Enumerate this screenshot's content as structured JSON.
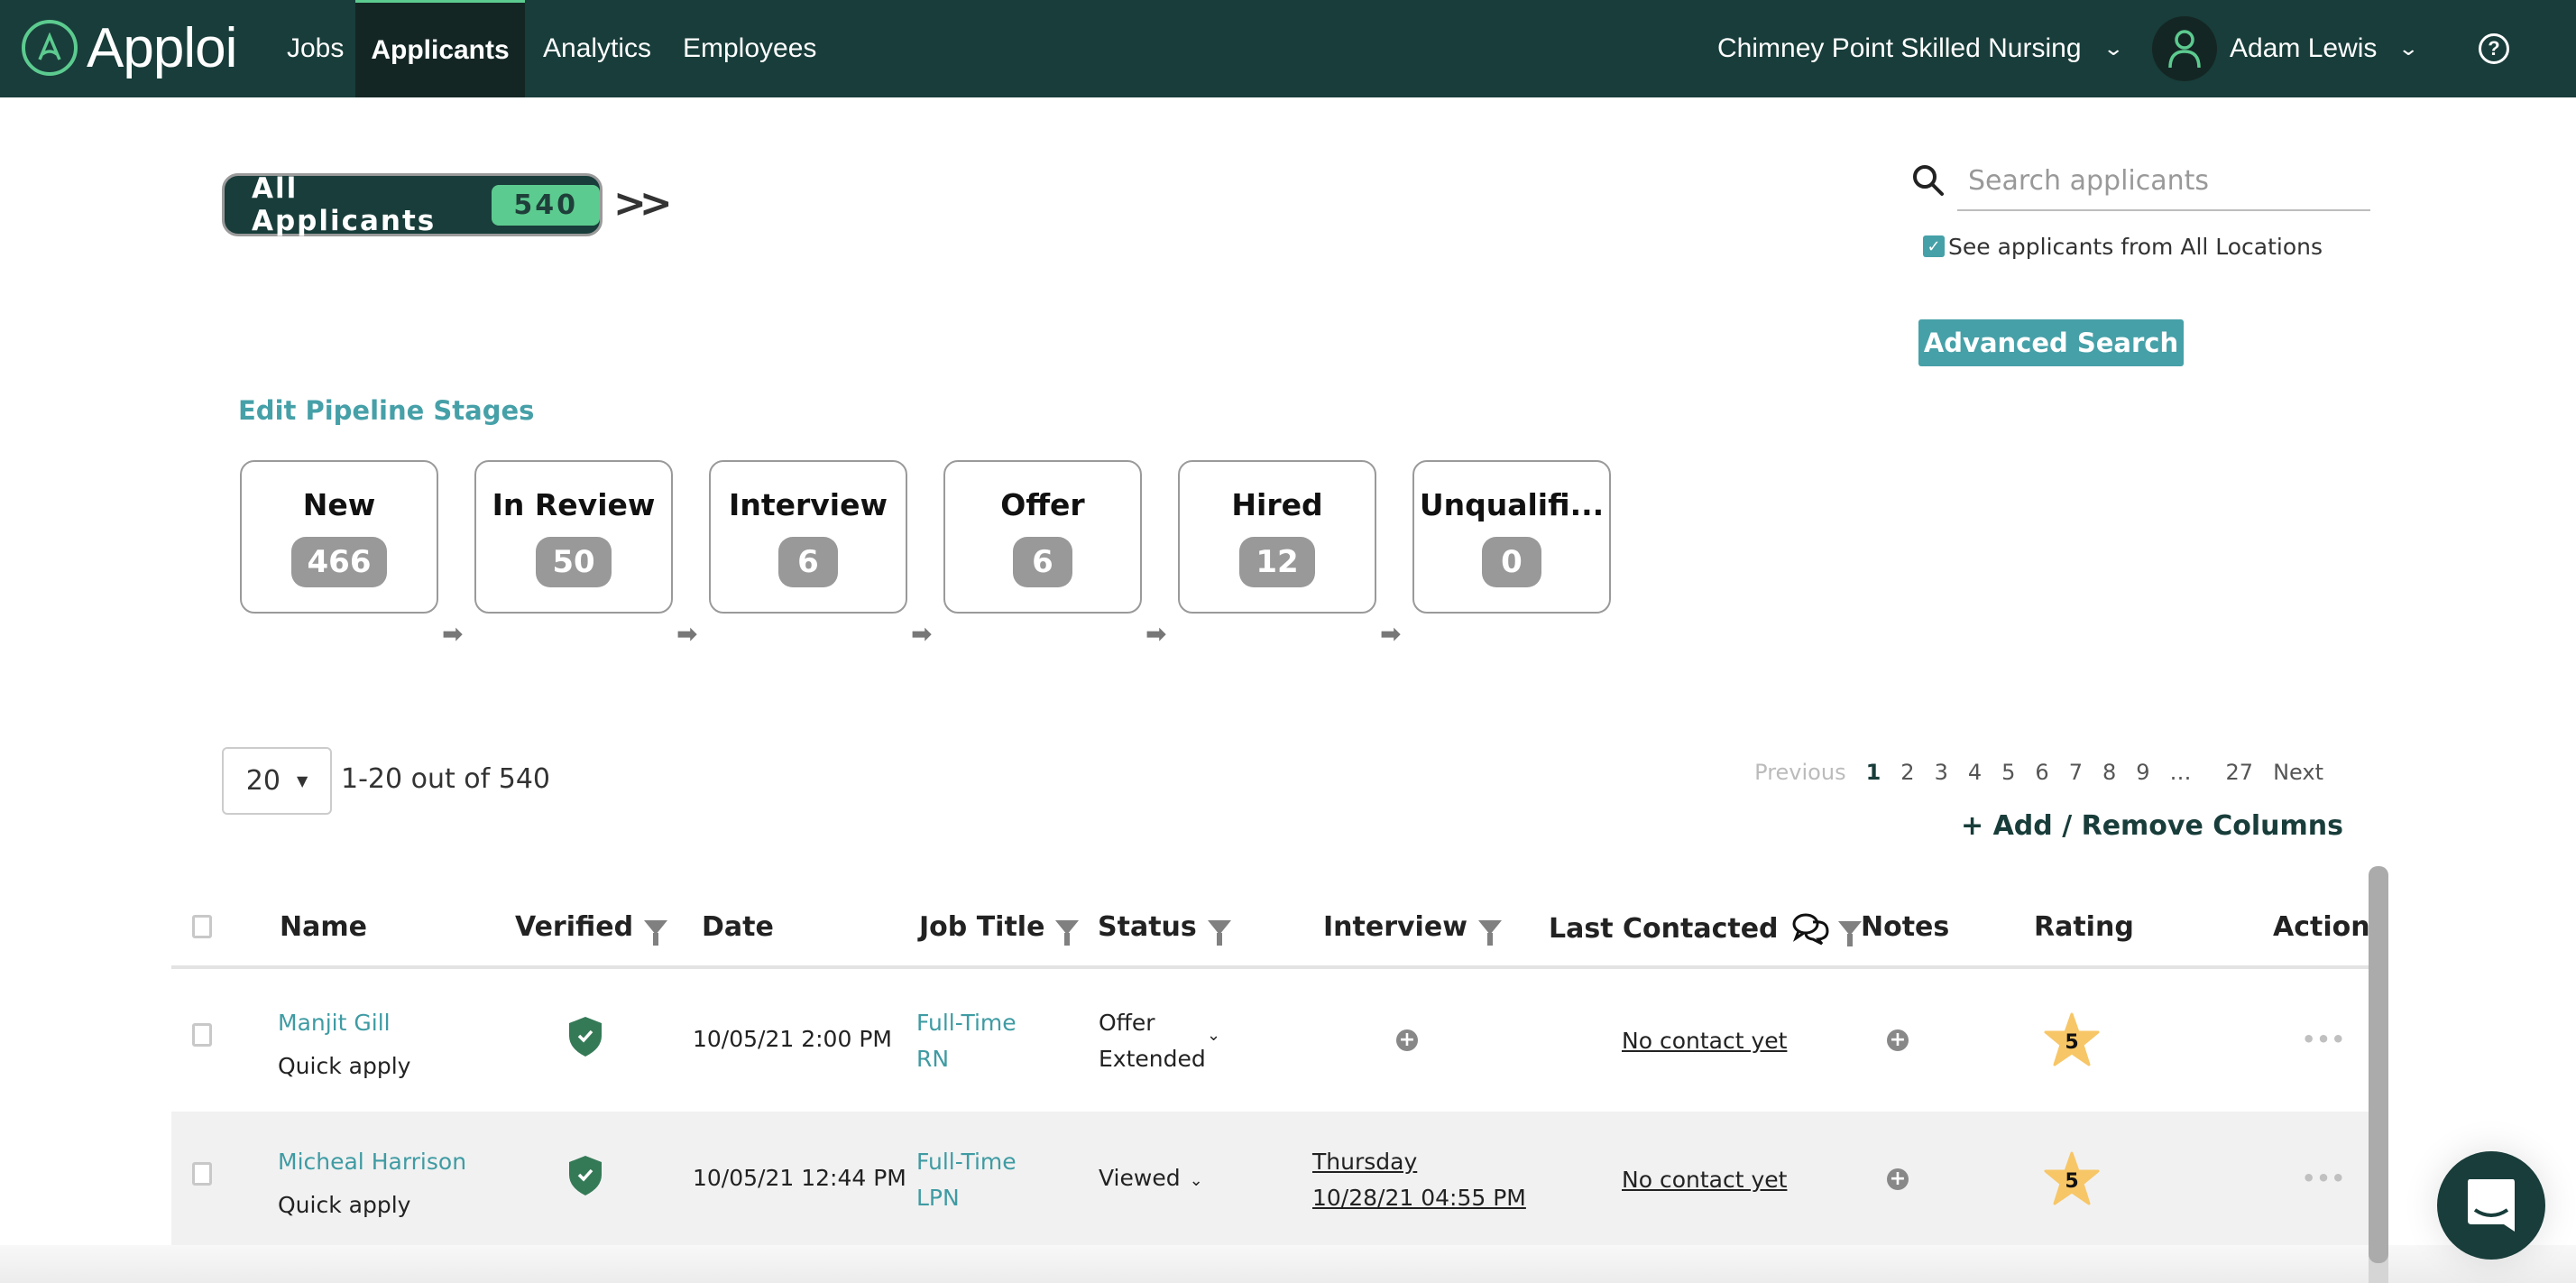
{
  "nav": {
    "brand": "Apploi",
    "links": [
      "Jobs",
      "Applicants",
      "Analytics",
      "Employees"
    ],
    "active": "Applicants",
    "location": "Chimney Point Skilled Nursing",
    "user": "Adam Lewis",
    "help_icon": "help-circle-icon"
  },
  "filter": {
    "label": "All Applicants",
    "count": "540"
  },
  "search": {
    "placeholder": "Search applicants",
    "value": "",
    "all_locations_label": "See applicants from All Locations",
    "all_locations_checked": true,
    "advanced_label": "Advanced Search"
  },
  "pipeline": {
    "edit_label": "Edit Pipeline Stages",
    "stages": [
      {
        "name": "New",
        "count": "466"
      },
      {
        "name": "In Review",
        "count": "50"
      },
      {
        "name": "Interview",
        "count": "6"
      },
      {
        "name": "Offer",
        "count": "6"
      },
      {
        "name": "Hired",
        "count": "12"
      },
      {
        "name": "Unqualifi...",
        "count": "0"
      }
    ],
    "arrow": "➡"
  },
  "pagination": {
    "page_size": "20",
    "range": "1-20 out of 540",
    "previous": "Previous",
    "pages": [
      "1",
      "2",
      "3",
      "4",
      "5",
      "6",
      "7",
      "8",
      "9",
      "…",
      "27"
    ],
    "current": "1",
    "next": "Next",
    "add_columns": "+ Add / Remove Columns"
  },
  "table": {
    "columns": [
      "Name",
      "Verified",
      "Date",
      "Job Title",
      "Status",
      "Interview",
      "Last Contacted",
      "Notes",
      "Rating",
      "Actions"
    ],
    "rows": [
      {
        "name": "Manjit Gill",
        "source": "Quick apply",
        "verified": true,
        "date": "10/05/21 2:00 PM",
        "job_title_1": "Full-Time",
        "job_title_2": "RN",
        "status_1": "Offer",
        "status_2": "Extended",
        "interview_1": "",
        "interview_2": "",
        "last_contacted": "No contact yet",
        "rating": "5",
        "actions": "•••"
      },
      {
        "name": "Micheal Harrison",
        "source": "Quick apply",
        "verified": true,
        "date": "10/05/21 12:44 PM",
        "job_title_1": "Full-Time",
        "job_title_2": "LPN",
        "status_1": "Viewed",
        "status_2": "",
        "interview_1": "Thursday",
        "interview_2": "10/28/21 04:55 PM",
        "last_contacted": "No contact yet",
        "rating": "5",
        "actions": "•••"
      }
    ]
  },
  "colors": {
    "nav_bg": "#183d3a",
    "accent_green": "#5ccb8f",
    "teal": "#46a0a8",
    "star": "#f7c667",
    "shield": "#357a57"
  }
}
